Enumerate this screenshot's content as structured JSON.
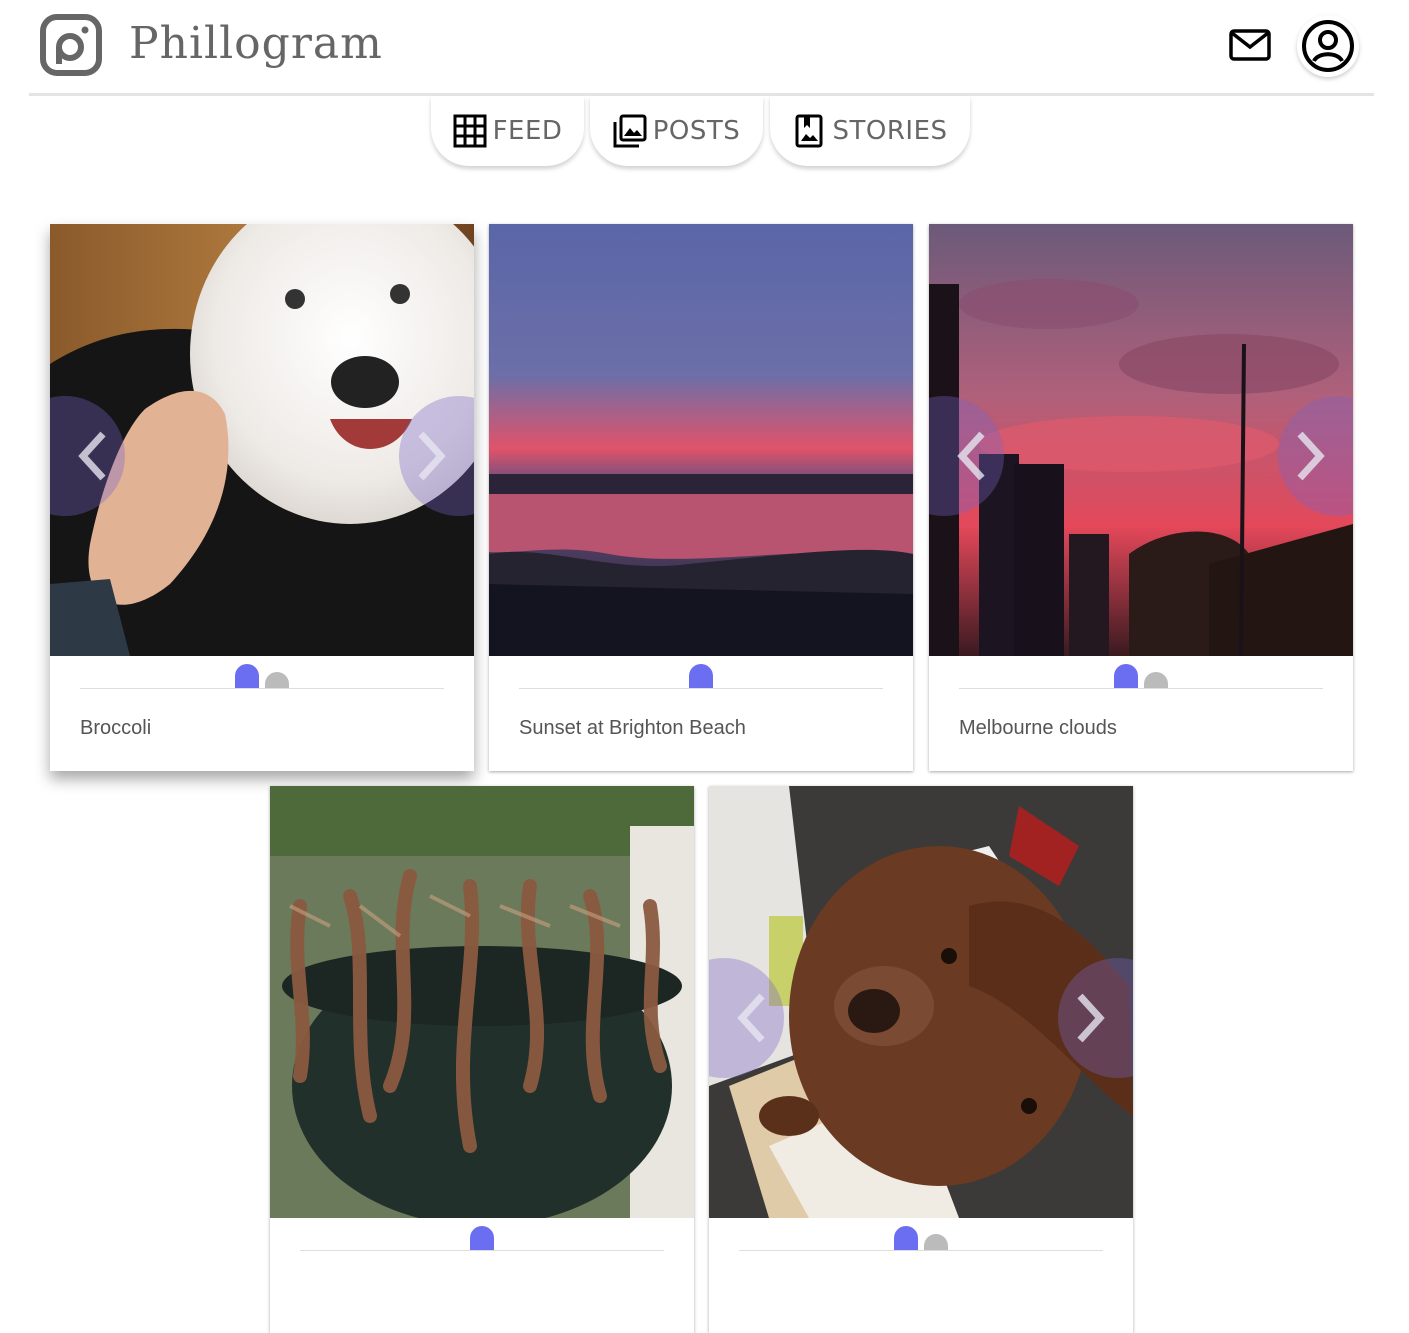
{
  "app": {
    "name": "Phillogram"
  },
  "header": {
    "mail_icon": "mail-icon",
    "profile_icon": "account-circle-icon"
  },
  "tabs": [
    {
      "label": "FEED",
      "icon": "grid-icon"
    },
    {
      "label": "POSTS",
      "icon": "photo-library-icon"
    },
    {
      "label": "STORIES",
      "icon": "bookmark-image-icon"
    }
  ],
  "posts": [
    {
      "caption": "Broccoli",
      "slides": 2,
      "active_slide": 1
    },
    {
      "caption": "Sunset at Brighton Beach",
      "slides": 1,
      "active_slide": 1
    },
    {
      "caption": "Melbourne clouds",
      "slides": 2,
      "active_slide": 1
    },
    {
      "caption": "",
      "slides": 1,
      "active_slide": 1
    },
    {
      "caption": "",
      "slides": 2,
      "active_slide": 1
    }
  ],
  "colors": {
    "accent": "#6b6ef0",
    "inactive_dot": "#bbbbbb",
    "text": "#555555"
  }
}
